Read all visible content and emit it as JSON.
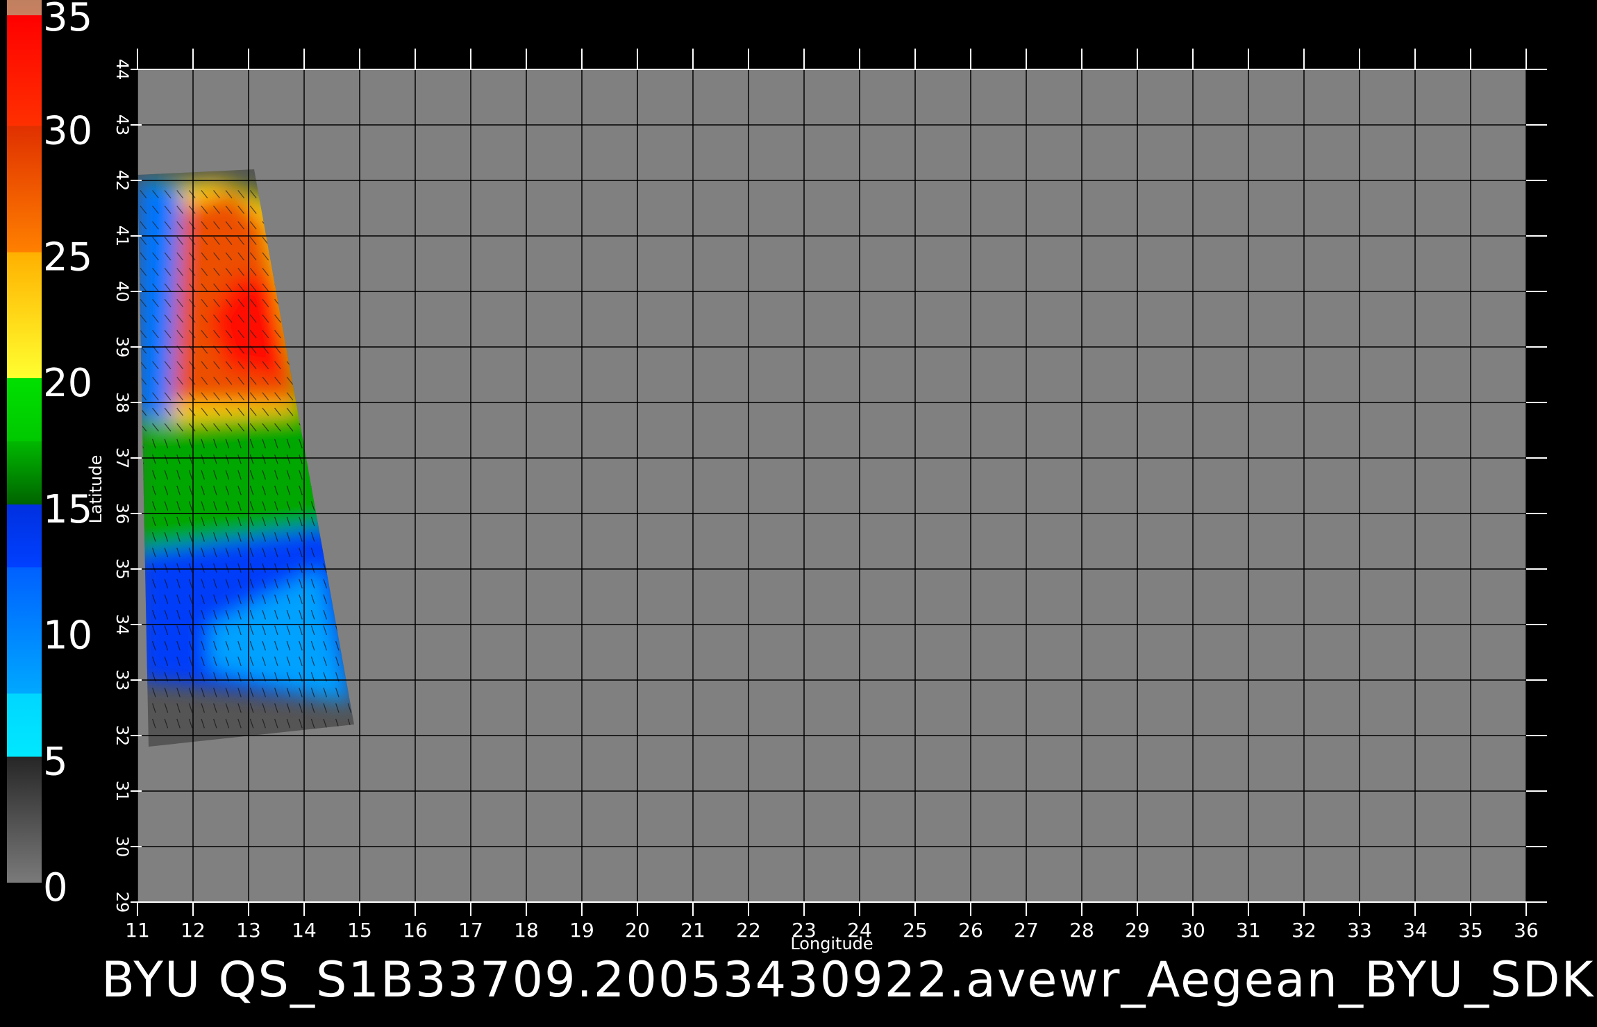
{
  "title": "BYU  QS_S1B33709.20053430922.avewr_Aegean_BYU_SDK",
  "colorbar": {
    "labels": [
      "0",
      "5",
      "10",
      "15",
      "20",
      "25",
      "30",
      "35"
    ],
    "min": 0,
    "max": 35,
    "bands": [
      {
        "from": 0,
        "to": 5,
        "color_start": "#7a7a7a",
        "color_end": "#262626"
      },
      {
        "from": 5,
        "to": 7.5,
        "color_start": "#00e8ff",
        "color_end": "#00d6ff"
      },
      {
        "from": 7.5,
        "to": 12.5,
        "color_start": "#00a8ff",
        "color_end": "#0060ff"
      },
      {
        "from": 12.5,
        "to": 15,
        "color_start": "#0040ff",
        "color_end": "#0030e0"
      },
      {
        "from": 15,
        "to": 17.5,
        "color_start": "#006400",
        "color_end": "#00b800"
      },
      {
        "from": 17.5,
        "to": 20,
        "color_start": "#00c800",
        "color_end": "#00e000"
      },
      {
        "from": 20,
        "to": 25,
        "color_start": "#ffff30",
        "color_end": "#ffb000"
      },
      {
        "from": 25,
        "to": 30,
        "color_start": "#ff8000",
        "color_end": "#e03000"
      },
      {
        "from": 30,
        "to": 34.4,
        "color_start": "#ff3000",
        "color_end": "#ff0000"
      },
      {
        "from": 34.4,
        "to": 35,
        "color_start": "#c88060",
        "color_end": "#c08060"
      }
    ]
  },
  "map": {
    "background_color": "#808080",
    "swath_shadow_color": "#555555",
    "lon_range": [
      11,
      36
    ],
    "lat_range": [
      29,
      44
    ],
    "lon_ticks": [
      "11",
      "12",
      "13",
      "14",
      "15",
      "16",
      "17",
      "18",
      "19",
      "20",
      "21",
      "22",
      "23",
      "24",
      "25",
      "26",
      "27",
      "28",
      "29",
      "30",
      "31",
      "32",
      "33",
      "34",
      "35",
      "36"
    ],
    "lat_ticks": [
      "29",
      "30",
      "31",
      "32",
      "33",
      "34",
      "35",
      "36",
      "37",
      "38",
      "39",
      "40",
      "41",
      "42",
      "43",
      "44"
    ],
    "xlabel": "Longitude",
    "ylabel": "Latitude",
    "swath_outline": [
      [
        11.2,
        31.8
      ],
      [
        14.9,
        32.2
      ],
      [
        13.1,
        42.2
      ],
      [
        11.0,
        42.1
      ]
    ],
    "wind_regions": [
      {
        "value": 33,
        "poly": [
          [
            12.6,
            38.6
          ],
          [
            13.8,
            38.4
          ],
          [
            13.5,
            40.2
          ],
          [
            12.8,
            40.3
          ],
          [
            12.3,
            39.5
          ]
        ]
      },
      {
        "value": 28,
        "poly": [
          [
            11.6,
            38.0
          ],
          [
            13.9,
            38.0
          ],
          [
            13.3,
            41.2
          ],
          [
            12.7,
            41.8
          ],
          [
            11.8,
            41.5
          ]
        ]
      },
      {
        "value": 23,
        "poly": [
          [
            11.3,
            37.6
          ],
          [
            13.9,
            37.8
          ],
          [
            13.5,
            41.5
          ],
          [
            12.4,
            42.0
          ],
          [
            11.4,
            41.8
          ]
        ]
      },
      {
        "value": 17,
        "poly": [
          [
            11.0,
            35.3
          ],
          [
            14.6,
            35.8
          ],
          [
            13.6,
            41.6
          ],
          [
            12.6,
            42.0
          ],
          [
            11.0,
            42.0
          ]
        ]
      },
      {
        "value": 13,
        "poly": [
          [
            11.0,
            33.0
          ],
          [
            14.9,
            32.6
          ],
          [
            14.6,
            35.8
          ],
          [
            12.4,
            36.6
          ],
          [
            11.0,
            36.0
          ]
        ]
      },
      {
        "value": 8,
        "poly": [
          [
            12.3,
            33.2
          ],
          [
            14.8,
            32.6
          ],
          [
            14.3,
            35.0
          ],
          [
            12.3,
            34.0
          ]
        ]
      },
      {
        "value": 11,
        "poly": [
          [
            11.0,
            37.8
          ],
          [
            11.6,
            37.6
          ],
          [
            11.8,
            41.8
          ],
          [
            11.0,
            42.0
          ]
        ]
      }
    ]
  }
}
